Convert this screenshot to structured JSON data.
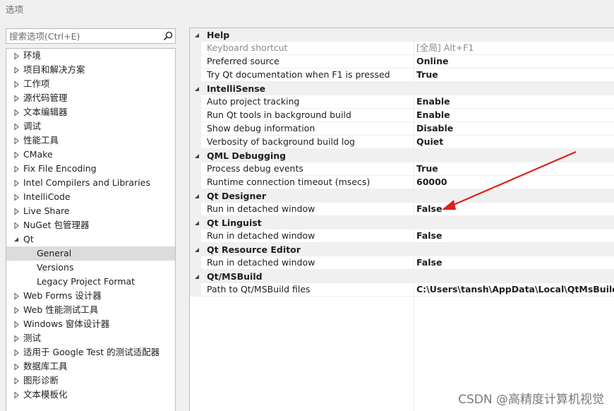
{
  "window": {
    "title": "选项"
  },
  "search": {
    "placeholder": "搜索选项(Ctrl+E)"
  },
  "tree": {
    "items": [
      {
        "label": "环境",
        "level": 0,
        "arrow": "collapsed",
        "name": "tree-item-environment"
      },
      {
        "label": "项目和解决方案",
        "level": 0,
        "arrow": "collapsed",
        "name": "tree-item-projects-solutions"
      },
      {
        "label": "工作项",
        "level": 0,
        "arrow": "collapsed",
        "name": "tree-item-work-items"
      },
      {
        "label": "源代码管理",
        "level": 0,
        "arrow": "collapsed",
        "name": "tree-item-source-control"
      },
      {
        "label": "文本编辑器",
        "level": 0,
        "arrow": "collapsed",
        "name": "tree-item-text-editor"
      },
      {
        "label": "调试",
        "level": 0,
        "arrow": "collapsed",
        "name": "tree-item-debugging"
      },
      {
        "label": "性能工具",
        "level": 0,
        "arrow": "collapsed",
        "name": "tree-item-performance-tools"
      },
      {
        "label": "CMake",
        "level": 0,
        "arrow": "collapsed",
        "name": "tree-item-cmake"
      },
      {
        "label": "Fix File Encoding",
        "level": 0,
        "arrow": "collapsed",
        "name": "tree-item-fix-file-encoding"
      },
      {
        "label": "Intel Compilers and Libraries",
        "level": 0,
        "arrow": "collapsed",
        "name": "tree-item-intel-compilers"
      },
      {
        "label": "IntelliCode",
        "level": 0,
        "arrow": "collapsed",
        "name": "tree-item-intellicode"
      },
      {
        "label": "Live Share",
        "level": 0,
        "arrow": "collapsed",
        "name": "tree-item-live-share"
      },
      {
        "label": "NuGet 包管理器",
        "level": 0,
        "arrow": "collapsed",
        "name": "tree-item-nuget"
      },
      {
        "label": "Qt",
        "level": 0,
        "arrow": "expanded",
        "name": "tree-item-qt"
      },
      {
        "label": "General",
        "level": 1,
        "arrow": "none",
        "selected": true,
        "name": "tree-item-qt-general"
      },
      {
        "label": "Versions",
        "level": 1,
        "arrow": "none",
        "name": "tree-item-qt-versions"
      },
      {
        "label": "Legacy Project Format",
        "level": 1,
        "arrow": "none",
        "name": "tree-item-qt-legacy-project-format"
      },
      {
        "label": "Web Forms 设计器",
        "level": 0,
        "arrow": "collapsed",
        "name": "tree-item-web-forms-designer"
      },
      {
        "label": "Web 性能测试工具",
        "level": 0,
        "arrow": "collapsed",
        "name": "tree-item-web-perf-test-tools"
      },
      {
        "label": "Windows 窗体设计器",
        "level": 0,
        "arrow": "collapsed",
        "name": "tree-item-windows-forms-designer"
      },
      {
        "label": "测试",
        "level": 0,
        "arrow": "collapsed",
        "name": "tree-item-test"
      },
      {
        "label": "适用于 Google Test 的测试适配器",
        "level": 0,
        "arrow": "collapsed",
        "name": "tree-item-google-test-adapter"
      },
      {
        "label": "数据库工具",
        "level": 0,
        "arrow": "collapsed",
        "name": "tree-item-database-tools"
      },
      {
        "label": "图形诊断",
        "level": 0,
        "arrow": "collapsed",
        "name": "tree-item-graphics-diagnostics"
      },
      {
        "label": "文本模板化",
        "level": 0,
        "arrow": "collapsed",
        "name": "tree-item-text-templating"
      }
    ]
  },
  "properties": {
    "categories": [
      {
        "label": "Help",
        "rows": [
          {
            "name": "Keyboard shortcut",
            "value": "[全局] Alt+F1",
            "disabled": true
          },
          {
            "name": "Preferred source",
            "value": "Online"
          },
          {
            "name": "Try Qt documentation when F1 is pressed",
            "value": "True"
          }
        ]
      },
      {
        "label": "IntelliSense",
        "rows": [
          {
            "name": "Auto project tracking",
            "value": "Enable"
          },
          {
            "name": "Run Qt tools in background build",
            "value": "Enable"
          },
          {
            "name": "Show debug information",
            "value": "Disable"
          },
          {
            "name": "Verbosity of background build log",
            "value": "Quiet"
          }
        ]
      },
      {
        "label": "QML Debugging",
        "rows": [
          {
            "name": "Process debug events",
            "value": "True"
          },
          {
            "name": "Runtime connection timeout (msecs)",
            "value": "60000"
          }
        ]
      },
      {
        "label": "Qt Designer",
        "rows": [
          {
            "name": "Run in detached window",
            "value": "False"
          }
        ]
      },
      {
        "label": "Qt Linguist",
        "rows": [
          {
            "name": "Run in detached window",
            "value": "False"
          }
        ]
      },
      {
        "label": "Qt Resource Editor",
        "rows": [
          {
            "name": "Run in detached window",
            "value": "False"
          }
        ]
      },
      {
        "label": "Qt/MSBuild",
        "rows": [
          {
            "name": "Path to Qt/MSBuild files",
            "value": "C:\\Users\\tansh\\AppData\\Local\\QtMsBuild"
          }
        ]
      }
    ]
  },
  "annotation": {
    "color": "#e0201b"
  },
  "watermark": {
    "text": "CSDN @高精度计算机视觉"
  },
  "colors": {
    "selected": "#dcdcdc",
    "category_bg": "#f0f0f0",
    "disabled_text": "#8a8a8a"
  }
}
